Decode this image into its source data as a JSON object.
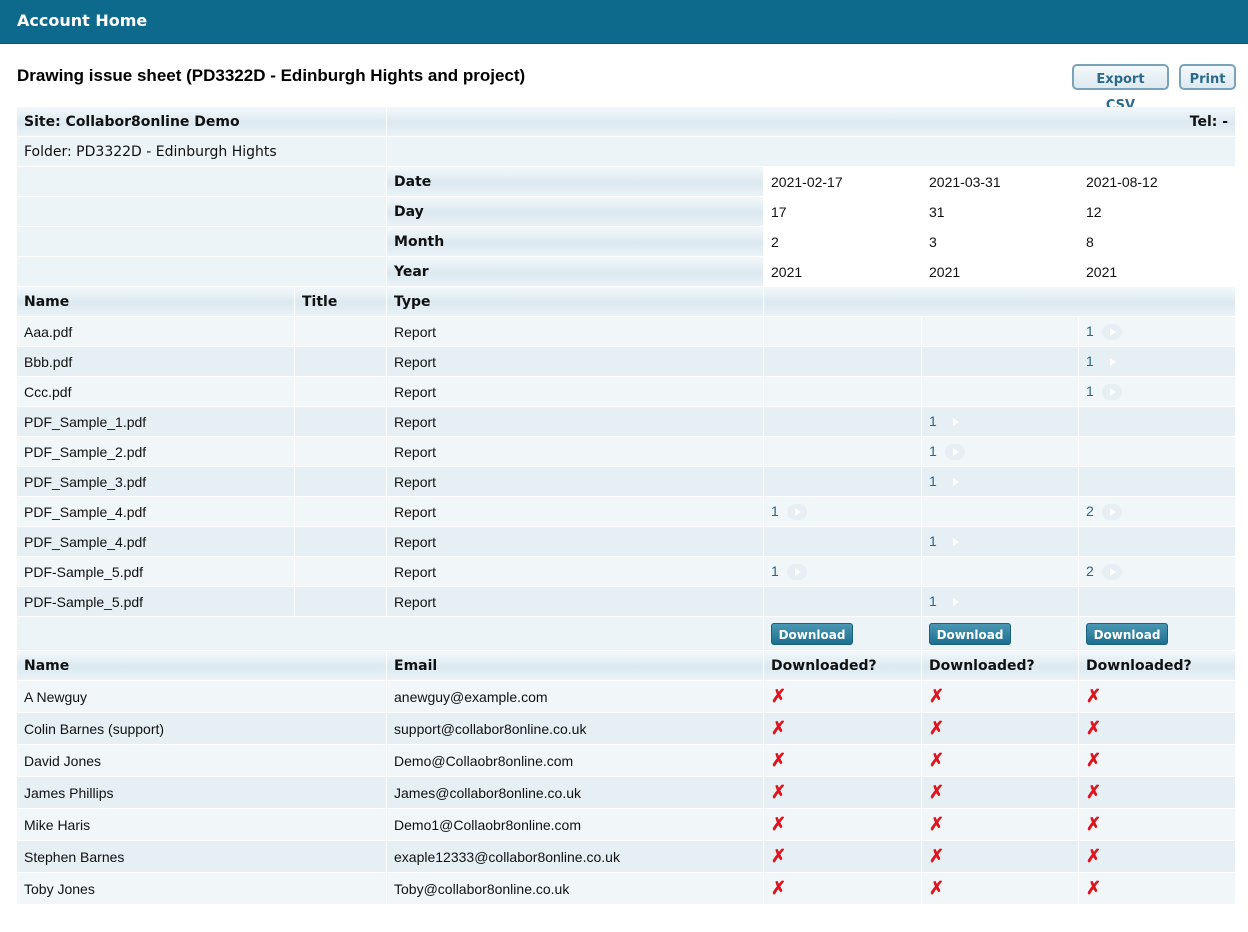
{
  "header": {
    "title": "Account Home"
  },
  "page": {
    "title": "Drawing issue sheet (PD3322D - Edinburgh Hights and project)"
  },
  "toolbar": {
    "export_label": "Export CSV",
    "print_label": "Print"
  },
  "info": {
    "site": "Site: Collabor8online Demo",
    "tel": "Tel: -",
    "folder": "Folder: PD3322D - Edinburgh Hights"
  },
  "issue_labels": {
    "date": "Date",
    "day": "Day",
    "month": "Month",
    "year": "Year"
  },
  "issues": [
    {
      "date": "2021-02-17",
      "day": "17",
      "month": "2",
      "year": "2021"
    },
    {
      "date": "2021-03-31",
      "day": "31",
      "month": "3",
      "year": "2021"
    },
    {
      "date": "2021-08-12",
      "day": "12",
      "month": "8",
      "year": "2021"
    }
  ],
  "files_header": {
    "name": "Name",
    "title": "Title",
    "type": "Type"
  },
  "files": [
    {
      "name": "Aaa.pdf",
      "title": "",
      "type": "Report",
      "revs": [
        "",
        "",
        "1"
      ]
    },
    {
      "name": "Bbb.pdf",
      "title": "",
      "type": "Report",
      "revs": [
        "",
        "",
        "1"
      ]
    },
    {
      "name": "Ccc.pdf",
      "title": "",
      "type": "Report",
      "revs": [
        "",
        "",
        "1"
      ]
    },
    {
      "name": "PDF_Sample_1.pdf",
      "title": "",
      "type": "Report",
      "revs": [
        "",
        "1",
        ""
      ]
    },
    {
      "name": "PDF_Sample_2.pdf",
      "title": "",
      "type": "Report",
      "revs": [
        "",
        "1",
        ""
      ]
    },
    {
      "name": "PDF_Sample_3.pdf",
      "title": "",
      "type": "Report",
      "revs": [
        "",
        "1",
        ""
      ]
    },
    {
      "name": "PDF_Sample_4.pdf",
      "title": "",
      "type": "Report",
      "revs": [
        "1",
        "",
        "2"
      ]
    },
    {
      "name": "PDF_Sample_4.pdf",
      "title": "",
      "type": "Report",
      "revs": [
        "",
        "1",
        ""
      ]
    },
    {
      "name": "PDF-Sample_5.pdf",
      "title": "",
      "type": "Report",
      "revs": [
        "1",
        "",
        "2"
      ]
    },
    {
      "name": "PDF-Sample_5.pdf",
      "title": "",
      "type": "Report",
      "revs": [
        "",
        "1",
        ""
      ]
    }
  ],
  "download_label": "Download",
  "recipients_header": {
    "name": "Name",
    "email": "Email",
    "downloaded": "Downloaded?"
  },
  "recipients": [
    {
      "name": "A Newguy",
      "email": "anewguy@example.com",
      "downloaded": [
        "✗",
        "✗",
        "✗"
      ]
    },
    {
      "name": "Colin Barnes (support)",
      "email": "support@collabor8online.co.uk",
      "downloaded": [
        "✗",
        "✗",
        "✗"
      ]
    },
    {
      "name": "David Jones",
      "email": "Demo@Collaobr8online.com",
      "downloaded": [
        "✗",
        "✗",
        "✗"
      ]
    },
    {
      "name": "James Phillips",
      "email": "James@collabor8online.co.uk",
      "downloaded": [
        "✗",
        "✗",
        "✗"
      ]
    },
    {
      "name": "Mike Haris",
      "email": "Demo1@Collaobr8online.com",
      "downloaded": [
        "✗",
        "✗",
        "✗"
      ]
    },
    {
      "name": "Stephen Barnes",
      "email": "exaple12333@collabor8online.co.uk",
      "downloaded": [
        "✗",
        "✗",
        "✗"
      ]
    },
    {
      "name": "Toby Jones",
      "email": "Toby@collabor8online.co.uk",
      "downloaded": [
        "✗",
        "✗",
        "✗"
      ]
    }
  ],
  "colors": {
    "header_bg": "#0e6a8c",
    "accent_text": "#2a6582",
    "cross": "#e0141e"
  },
  "icons": {
    "revision": "play-icon",
    "not_downloaded": "cross-icon"
  }
}
